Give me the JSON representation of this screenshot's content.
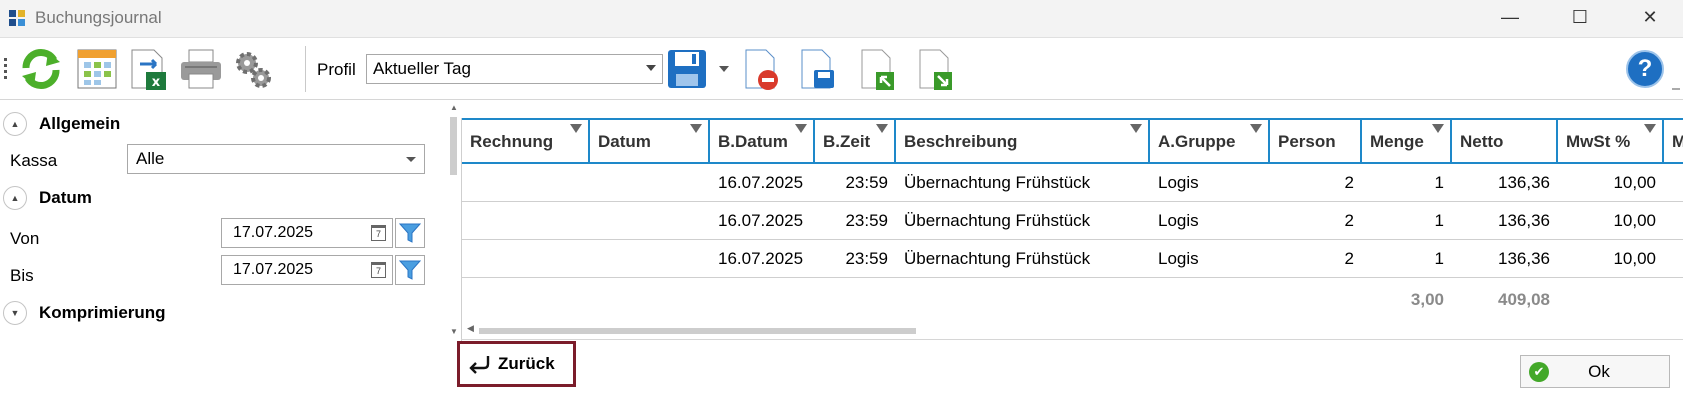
{
  "window": {
    "title": "Buchungsjournal",
    "minimize_glyph": "—",
    "maximize_glyph": "☐",
    "close_glyph": "✕"
  },
  "toolbar": {
    "icons": [
      "refresh-icon",
      "calendar-grid-icon",
      "export-excel-icon",
      "printer-icon",
      "settings-gears-icon",
      "save-profile-icon",
      "delete-profile-icon",
      "save-as-icon",
      "import-icon",
      "export-icon",
      "help-icon"
    ],
    "profil_label": "Profil",
    "profil_value": "Aktueller Tag",
    "help_glyph": "?"
  },
  "filters": {
    "allgemein_title": "Allgemein",
    "kassa_label": "Kassa",
    "kassa_value": "Alle",
    "datum_title": "Datum",
    "von_label": "Von",
    "von_value": "17.07.2025",
    "bis_label": "Bis",
    "bis_value": "17.07.2025",
    "komprimierung_title": "Komprimierung",
    "calendar_day": "7"
  },
  "grid": {
    "columns": [
      "Rechnung",
      "Datum",
      "B.Datum",
      "B.Zeit",
      "Beschreibung",
      "A.Gruppe",
      "Person",
      "Menge",
      "Netto",
      "MwSt %",
      "M"
    ],
    "rows": [
      {
        "rechnung": "",
        "datum": "",
        "bdatum": "16.07.2025",
        "bzeit": "23:59",
        "beschreibung": "Übernachtung Frühstück",
        "agruppe": "Logis",
        "person": "2",
        "menge": "1",
        "netto": "136,36",
        "mwst": "10,00"
      },
      {
        "rechnung": "",
        "datum": "",
        "bdatum": "16.07.2025",
        "bzeit": "23:59",
        "beschreibung": "Übernachtung Frühstück",
        "agruppe": "Logis",
        "person": "2",
        "menge": "1",
        "netto": "136,36",
        "mwst": "10,00"
      },
      {
        "rechnung": "",
        "datum": "",
        "bdatum": "16.07.2025",
        "bzeit": "23:59",
        "beschreibung": "Übernachtung Frühstück",
        "agruppe": "Logis",
        "person": "2",
        "menge": "1",
        "netto": "136,36",
        "mwst": "10,00"
      }
    ],
    "totals": {
      "menge": "3,00",
      "netto": "409,08"
    }
  },
  "actions": {
    "back_label": "Zurück",
    "ok_label": "Ok"
  },
  "colors": {
    "accent_blue": "#1e88c9",
    "back_border": "#7b1c2a",
    "ok_check": "#43a829"
  }
}
